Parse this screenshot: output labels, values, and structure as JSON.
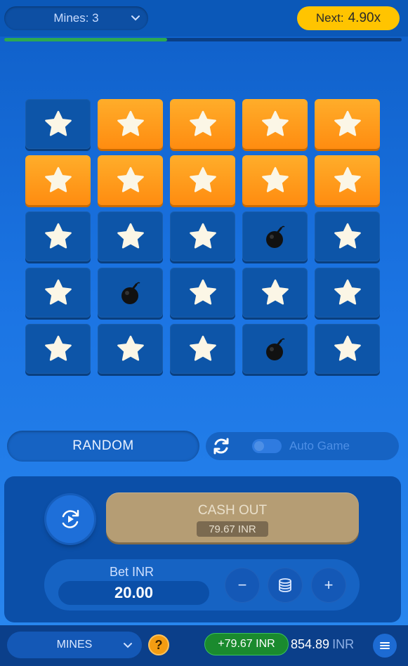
{
  "header": {
    "mines_select": "Mines: 3",
    "next_label": "Next:",
    "next_multiplier": "4.90x",
    "progress_fraction": 0.41
  },
  "grid": {
    "rows": 5,
    "cols": 5,
    "tiles": [
      "star-closed",
      "star-open",
      "star-open",
      "star-open",
      "star-open",
      "star-open",
      "star-open",
      "star-open",
      "star-open",
      "star-open",
      "star-closed",
      "star-closed",
      "star-closed",
      "bomb",
      "star-closed",
      "star-closed",
      "bomb",
      "star-closed",
      "star-closed",
      "star-closed",
      "star-closed",
      "star-closed",
      "star-closed",
      "bomb",
      "star-closed"
    ]
  },
  "controls": {
    "random_label": "RANDOM",
    "auto_game_label": "Auto Game",
    "auto_game_on": false
  },
  "cashout": {
    "label": "CASH OUT",
    "amount": "79.67 INR"
  },
  "bet": {
    "label": "Bet INR",
    "value": "20.00",
    "minus": "−",
    "plus": "+"
  },
  "footer": {
    "game_select": "MINES",
    "help": "?",
    "win": "+79.67 INR",
    "balance": "854.89",
    "currency": "INR"
  },
  "colors": {
    "accent_yellow": "#ffc400",
    "tile_open": "#ff9a1a",
    "tile_closed": "#0d55a8",
    "win_green": "#1a8a2e"
  }
}
